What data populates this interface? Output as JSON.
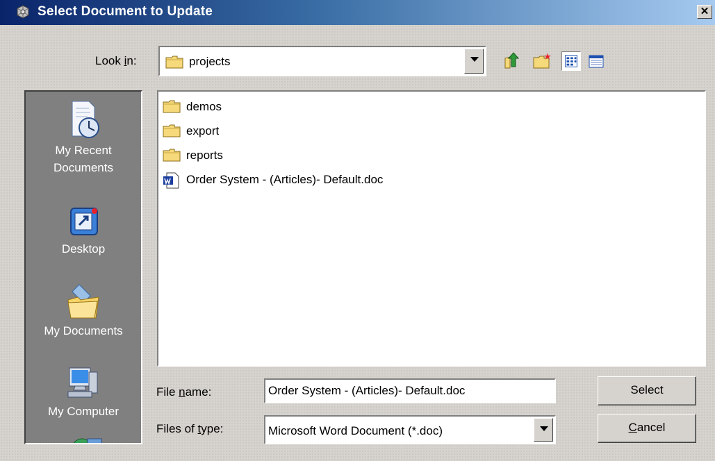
{
  "window": {
    "title": "Select Document to Update",
    "close_glyph": "✕"
  },
  "look_in": {
    "label_prefix": "Look ",
    "label_mnemonic": "i",
    "label_suffix": "n:",
    "value": "projects"
  },
  "toolbar": {
    "icons": [
      "up-one-level-icon",
      "create-new-folder-icon",
      "list-view-icon",
      "details-view-icon"
    ],
    "active_view": "list"
  },
  "places": [
    {
      "label_line1": "My Recent",
      "label_line2": "Documents",
      "icon": "recent-documents-icon"
    },
    {
      "label_line1": "Desktop",
      "label_line2": "",
      "icon": "desktop-icon"
    },
    {
      "label_line1": "My Documents",
      "label_line2": "",
      "icon": "my-documents-icon"
    },
    {
      "label_line1": "My Computer",
      "label_line2": "",
      "icon": "my-computer-icon"
    }
  ],
  "files": [
    {
      "name": "demos",
      "type": "folder"
    },
    {
      "name": "export",
      "type": "folder"
    },
    {
      "name": "reports",
      "type": "folder"
    },
    {
      "name": "Order System - (Articles)- Default.doc",
      "type": "word-document"
    }
  ],
  "file_name": {
    "label_prefix": "File ",
    "label_mnemonic": "n",
    "label_suffix": "ame:",
    "value": "Order System - (Articles)- Default.doc"
  },
  "file_type": {
    "label_prefix": "Files of ",
    "label_mnemonic": "t",
    "label_suffix": "ype:",
    "value": "Microsoft Word Document (*.doc)"
  },
  "buttons": {
    "select": "Select",
    "cancel_mnemonic": "C",
    "cancel_rest": "ancel"
  },
  "colors": {
    "title_start": "#0a246a",
    "title_end": "#a6caf0",
    "dialog_bg": "#d6d3ce",
    "places_bg": "#808080"
  }
}
